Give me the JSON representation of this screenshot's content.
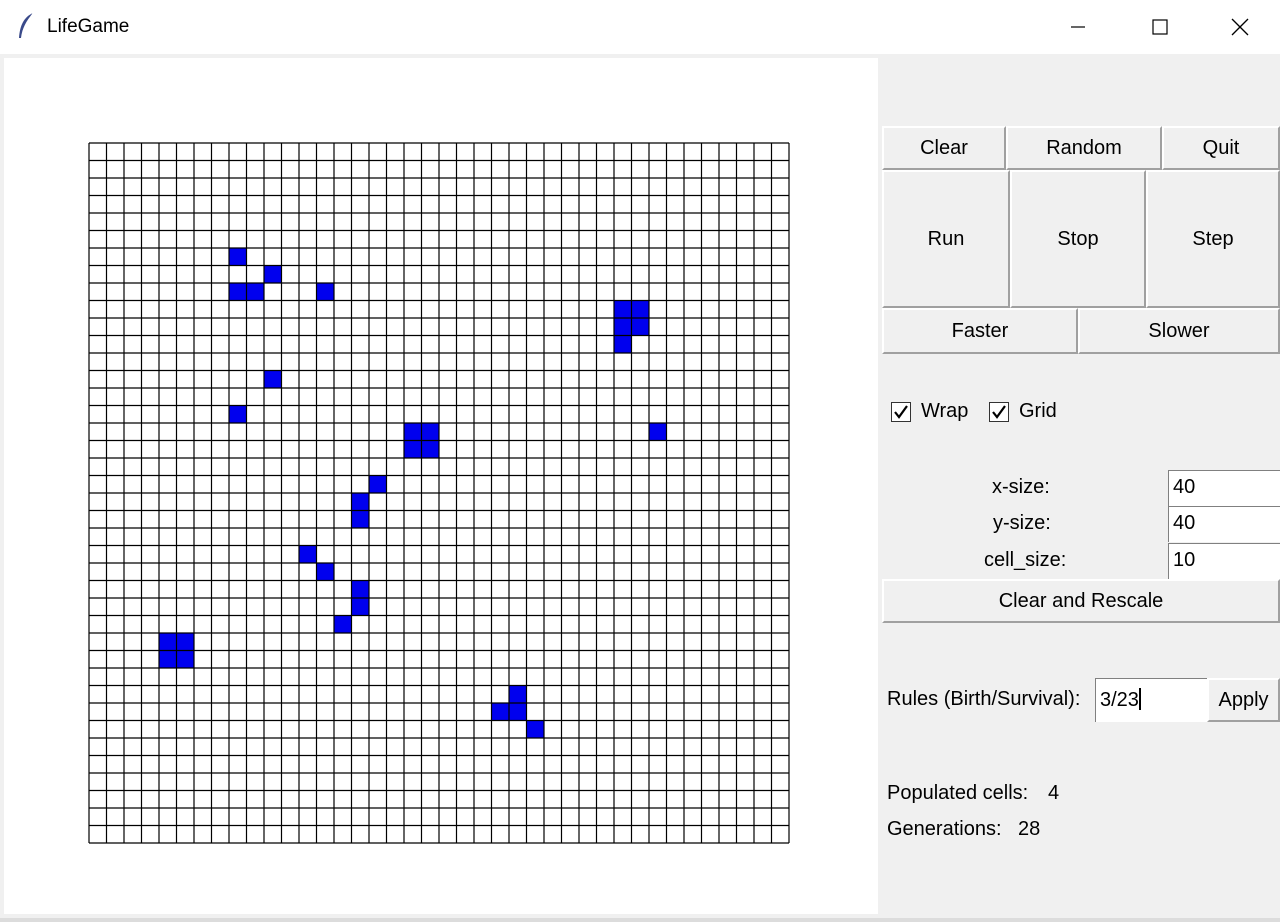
{
  "window": {
    "title": "LifeGame",
    "icon": "feather-icon",
    "controls": [
      "minimize-icon",
      "maximize-icon",
      "close-icon"
    ]
  },
  "buttons": {
    "clear": "Clear",
    "random": "Random",
    "quit": "Quit",
    "run": "Run",
    "stop": "Stop",
    "step": "Step",
    "faster": "Faster",
    "slower": "Slower",
    "clear_rescale": "Clear and Rescale",
    "apply": "Apply"
  },
  "options": {
    "wrap": {
      "label": "Wrap",
      "checked": true
    },
    "grid": {
      "label": "Grid",
      "checked": true
    }
  },
  "settings": {
    "x_size": {
      "label": "x-size:",
      "value": "40"
    },
    "y_size": {
      "label": "y-size:",
      "value": "40"
    },
    "cell_size": {
      "label": "cell_size:",
      "value": "10"
    }
  },
  "rules": {
    "label": "Rules (Birth/Survival):",
    "value": "3/23"
  },
  "stats": {
    "populated_label": "Populated cells:",
    "populated_value": "4",
    "generations_label": "Generations:",
    "generations_value": "28"
  },
  "board": {
    "cols": 40,
    "rows": 40,
    "live_color": "#0000ee",
    "grid_color": "#000000",
    "live_cells": [
      [
        8,
        6
      ],
      [
        10,
        7
      ],
      [
        8,
        8
      ],
      [
        9,
        8
      ],
      [
        13,
        8
      ],
      [
        30,
        9
      ],
      [
        31,
        9
      ],
      [
        30,
        10
      ],
      [
        31,
        10
      ],
      [
        30,
        11
      ],
      [
        10,
        13
      ],
      [
        8,
        15
      ],
      [
        18,
        16
      ],
      [
        19,
        16
      ],
      [
        32,
        16
      ],
      [
        18,
        17
      ],
      [
        19,
        17
      ],
      [
        16,
        19
      ],
      [
        15,
        20
      ],
      [
        15,
        21
      ],
      [
        12,
        23
      ],
      [
        13,
        24
      ],
      [
        15,
        25
      ],
      [
        15,
        26
      ],
      [
        14,
        27
      ],
      [
        4,
        28
      ],
      [
        5,
        28
      ],
      [
        4,
        29
      ],
      [
        5,
        29
      ],
      [
        24,
        31
      ],
      [
        23,
        32
      ],
      [
        24,
        32
      ],
      [
        25,
        33
      ]
    ]
  }
}
